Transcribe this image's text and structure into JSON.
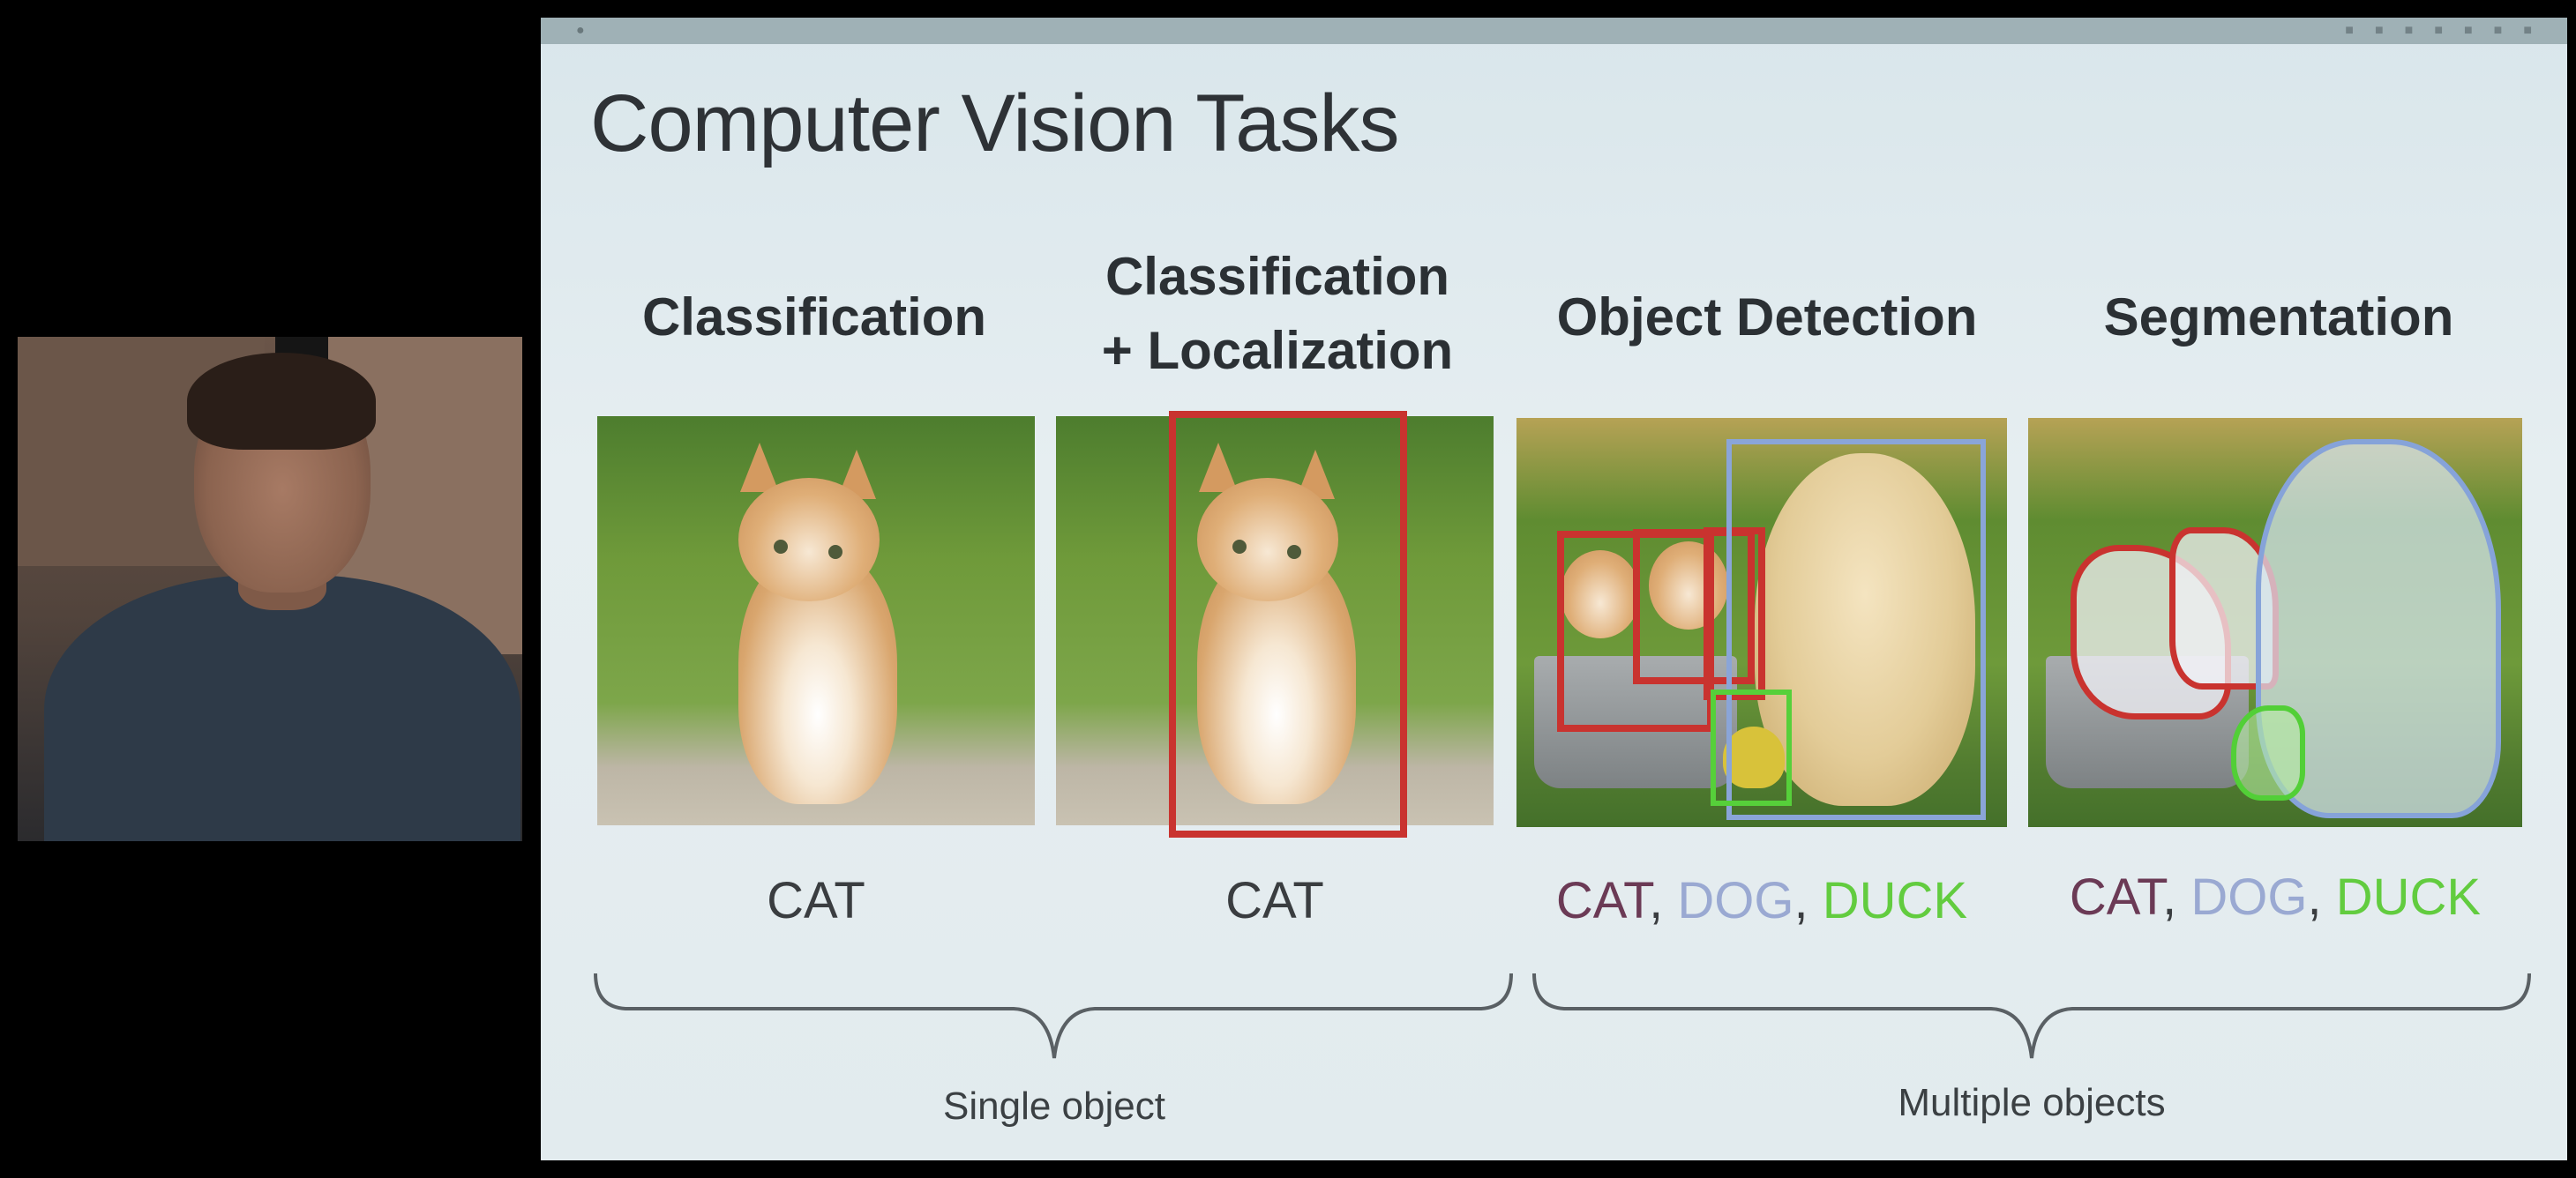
{
  "slide": {
    "title": "Computer Vision Tasks",
    "tasks": [
      {
        "heading": "Classification",
        "output": "CAT"
      },
      {
        "heading_line1": "Classification",
        "heading_line2": "+ Localization",
        "output": "CAT"
      },
      {
        "heading": "Object Detection",
        "output_parts": [
          "CAT",
          ", ",
          "DOG",
          ", ",
          "DUCK"
        ]
      },
      {
        "heading": "Segmentation",
        "output_parts": [
          "CAT",
          ", ",
          "DOG",
          ", ",
          "DUCK"
        ]
      }
    ],
    "groups": [
      {
        "label": "Single object"
      },
      {
        "label": "Multiple objects"
      }
    ]
  },
  "colors": {
    "cat": "#6b3a55",
    "dog": "#9aa9d2",
    "duck": "#62cc3f",
    "box_red": "#c9332f",
    "box_blue": "#8aa5d8",
    "box_green": "#56d03a"
  },
  "icons": [
    "apple-menu-icon",
    "status-bar-icons"
  ]
}
